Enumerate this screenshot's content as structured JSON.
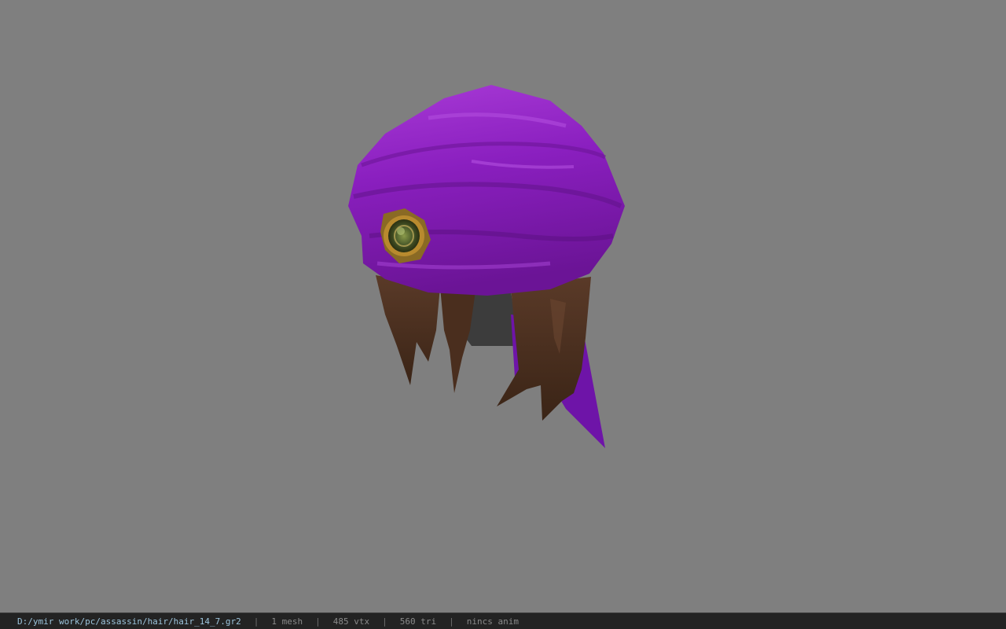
{
  "viewer": {
    "background_color": "#7f7f7f",
    "model_icon": "hair-mesh-icon"
  },
  "statusbar": {
    "file_path": "D:/ymir work/pc/assassin/hair/hair_14_7.gr2",
    "separator": "|",
    "mesh_count": "1 mesh",
    "vertex_count": "485 vtx",
    "triangle_count": "560 tri",
    "anim_status": "nincs anim"
  }
}
